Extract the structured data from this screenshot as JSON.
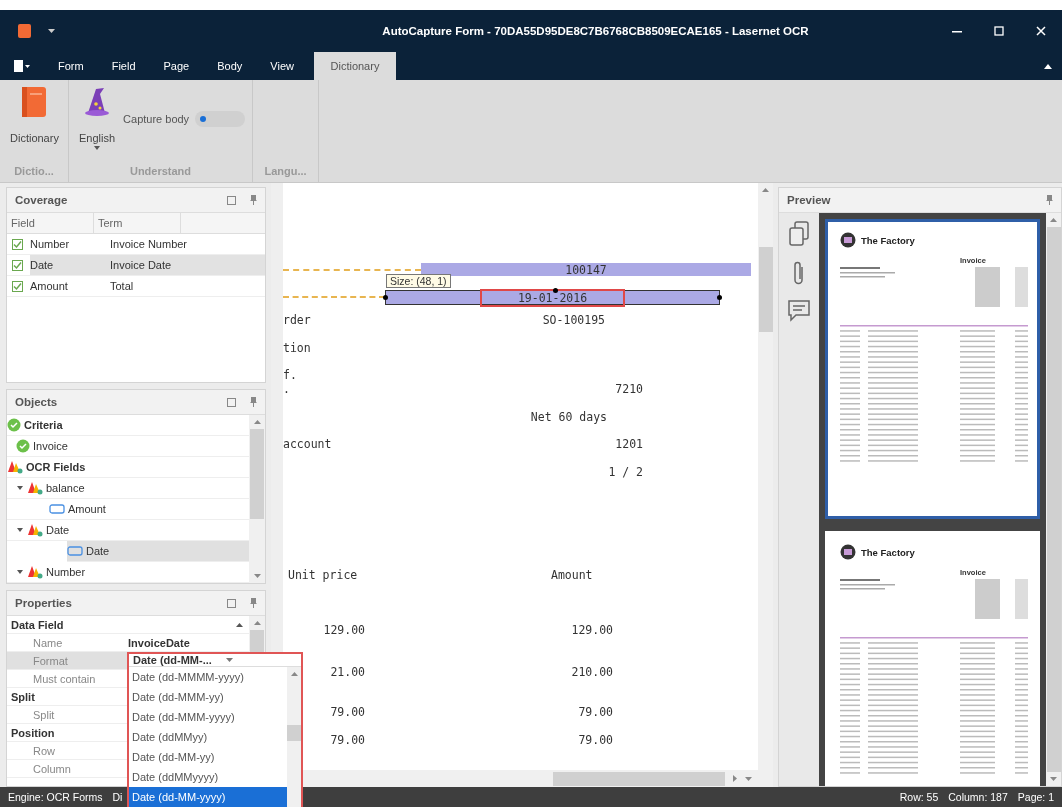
{
  "window": {
    "title": "AutoCapture Form - 70DA55D95DE8C7B6768CB8509ECAE165 - Lasernet OCR"
  },
  "ribbon_tabs": [
    {
      "label": "Form",
      "selected": false
    },
    {
      "label": "Field",
      "selected": false
    },
    {
      "label": "Page",
      "selected": false
    },
    {
      "label": "Body",
      "selected": false
    },
    {
      "label": "View",
      "selected": false
    },
    {
      "label": "Dictionary",
      "selected": true
    }
  ],
  "ribbon": {
    "groups": [
      {
        "label": "Dictio...",
        "items": [
          {
            "kind": "button",
            "label": "Dictionary"
          }
        ]
      },
      {
        "label": "Understand",
        "items": [
          {
            "kind": "dropdown",
            "label": "English"
          },
          {
            "kind": "toggle",
            "label": "Capture body",
            "on": false
          }
        ]
      },
      {
        "label": "Langu..."
      }
    ]
  },
  "coverage": {
    "title": "Coverage",
    "columns": [
      "Field",
      "Term"
    ],
    "rows": [
      {
        "field": "Number",
        "term": "Invoice Number",
        "checked": true,
        "selected": false
      },
      {
        "field": "Date",
        "term": "Invoice Date",
        "checked": true,
        "selected": true
      },
      {
        "field": "Amount",
        "term": "Total",
        "checked": true,
        "selected": false
      }
    ]
  },
  "objects": {
    "title": "Objects",
    "tree": [
      {
        "label": "Criteria",
        "kind": "criteria",
        "selected": false,
        "children": [
          {
            "label": "Invoice",
            "kind": "criterion",
            "selected": false
          }
        ]
      },
      {
        "label": "OCR Fields",
        "kind": "group",
        "selected": false,
        "children": [
          {
            "label": "balance",
            "kind": "field",
            "expanded": true,
            "selected": false,
            "children": [
              {
                "label": "Amount",
                "kind": "element",
                "selected": false
              }
            ]
          },
          {
            "label": "Date",
            "kind": "field",
            "expanded": true,
            "selected": false,
            "children": [
              {
                "label": "Date",
                "kind": "element",
                "selected": true
              }
            ]
          },
          {
            "label": "Number",
            "kind": "field",
            "expanded": true,
            "selected": false
          }
        ]
      }
    ]
  },
  "properties": {
    "title": "Properties",
    "sections": [
      {
        "label": "Data Field",
        "expanded": true,
        "rows": [
          {
            "name": "Name",
            "value": "InvoiceDate",
            "selected": false
          },
          {
            "name": "Format",
            "selected": true
          },
          {
            "name": "Must contain",
            "selected": false
          }
        ]
      },
      {
        "label": "Split",
        "expanded": true,
        "rows": [
          {
            "name": "Split",
            "selected": false
          }
        ]
      },
      {
        "label": "Position",
        "expanded": true,
        "rows": [
          {
            "name": "Row",
            "selected": false
          },
          {
            "name": "Column",
            "selected": false
          }
        ]
      }
    ]
  },
  "format_dropdown": {
    "value": "Date (dd-MM-...",
    "options": [
      {
        "label": "Date (dd-MMMM-yyyy)",
        "selected": false
      },
      {
        "label": "Date (dd-MMM-yy)",
        "selected": false
      },
      {
        "label": "Date (dd-MMM-yyyy)",
        "selected": false
      },
      {
        "label": "Date (ddMMyy)",
        "selected": false
      },
      {
        "label": "Date (dd-MM-yy)",
        "selected": false
      },
      {
        "label": "Date (ddMMyyyy)",
        "selected": false
      },
      {
        "label": "Date (dd-MM-yyyy)",
        "selected": true
      }
    ]
  },
  "document": {
    "fields": [
      {
        "text": "100147",
        "selected": false
      },
      {
        "text": "19-01-2016",
        "selected": true
      }
    ],
    "size_tooltip": "Size: (48, 1)",
    "lines": [
      {
        "label": "rder",
        "value": "SO-100195"
      },
      {
        "label": "tion"
      },
      {
        "label": "f."
      },
      {
        "label": ".",
        "value": "7210"
      },
      {
        "value": "Net 60 days"
      },
      {
        "label": " account",
        "value": "1201"
      },
      {
        "value": "1 / 2"
      }
    ],
    "table": {
      "columns": [
        "Unit price",
        "Amount"
      ],
      "rows": [
        [
          "129.00",
          "129.00"
        ],
        [
          "21.00",
          "210.00"
        ],
        [
          "79.00",
          "79.00"
        ],
        [
          "79.00",
          "79.00"
        ]
      ]
    }
  },
  "preview": {
    "title": "Preview",
    "pages": [
      {
        "company": "The Factory",
        "heading": "Invoice",
        "selected": true
      },
      {
        "company": "The Factory",
        "heading": "Invoice",
        "selected": false
      }
    ]
  },
  "status_bar": {
    "left": [
      "Engine: OCR Forms",
      "Di"
    ],
    "right": [
      "Row: 55",
      "Column: 187",
      "Page: 1"
    ]
  }
}
